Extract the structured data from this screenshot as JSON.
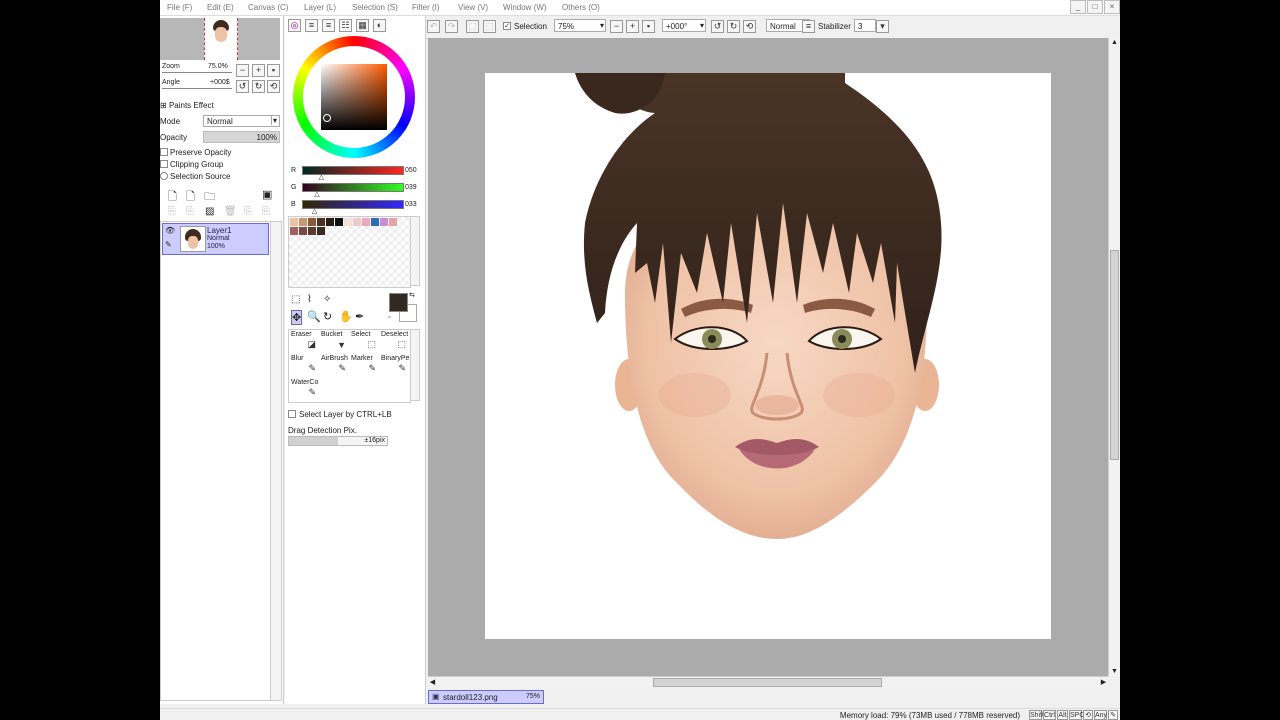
{
  "menu": [
    "File (F)",
    "Edit (E)",
    "Canvas (C)",
    "Layer (L)",
    "Selection (S)",
    "Filter (I)",
    "View (V)",
    "Window (W)",
    "Others (O)"
  ],
  "window_controls": [
    "_",
    "□",
    "×"
  ],
  "navigator": {
    "zoom_label": "Zoom",
    "zoom_value": "75.0%",
    "angle_label": "Angle",
    "angle_value": "+000$"
  },
  "layer_props": {
    "paints_effect": "Paints Effect",
    "mode_label": "Mode",
    "mode_value": "Normal",
    "opacity_label": "Opacity",
    "opacity_value": "100%",
    "preserve_opacity": "Preserve Opacity",
    "clipping_group": "Clipping Group",
    "selection_source": "Selection Source"
  },
  "layers": [
    {
      "name": "Layer1",
      "mode": "Normal",
      "opacity": "100%"
    }
  ],
  "color": {
    "r_label": "R",
    "r_value": "050",
    "g_label": "G",
    "g_value": "039",
    "b_label": "B",
    "b_value": "033",
    "current": "#322721",
    "r_fraction": 0.196,
    "g_fraction": 0.153,
    "b_fraction": 0.129
  },
  "swatches": [
    "#e8c4a4",
    "#c79a77",
    "#8a5a3c",
    "#4a3122",
    "#2a1c14",
    "#111111",
    "#f4e2d8",
    "#f0c8c8",
    "#e9a9c0",
    "#2a6fb4",
    "#c58fd0",
    "#e3a3a8",
    "#a36060",
    "#7a4b45",
    "#5c3a2c",
    "#3a2a22"
  ],
  "tools": [
    {
      "name": "Eraser",
      "icon": "eraser-icon",
      "glyph": "◪"
    },
    {
      "name": "Bucket",
      "icon": "bucket-icon",
      "glyph": "▼"
    },
    {
      "name": "Select",
      "icon": "select-icon",
      "glyph": "⬚"
    },
    {
      "name": "Deselect",
      "icon": "deselect-icon",
      "glyph": "⬚"
    },
    {
      "name": "Blur",
      "icon": "blur-icon",
      "glyph": "✎"
    },
    {
      "name": "AirBrush",
      "icon": "airbrush-icon",
      "glyph": "✎"
    },
    {
      "name": "Marker",
      "icon": "marker-icon",
      "glyph": "✎"
    },
    {
      "name": "BinaryPe",
      "icon": "binary-pen-icon",
      "glyph": "✎"
    },
    {
      "name": "WaterCo",
      "icon": "watercolor-icon",
      "glyph": "✎"
    }
  ],
  "options": {
    "select_layer": "Select Layer by CTRL+LB",
    "drag_detection": "Drag Detection Pix.",
    "drag_value": "±16pix"
  },
  "toolbar": {
    "selection_label": "Selection",
    "zoom_value": "75%",
    "angle_value": "+000°",
    "blend_value": "Normal",
    "stabilizer_label": "Stabilizer",
    "stabilizer_value": "3"
  },
  "document": {
    "name": "stardoll123.png",
    "zoom": "75%"
  },
  "status": {
    "memory": "Memory load: 79% (73MB used / 778MB reserved)",
    "keys": [
      "Shift",
      "Ctrl",
      "Alt",
      "SPC",
      "⟲",
      "Any",
      "✎"
    ]
  }
}
